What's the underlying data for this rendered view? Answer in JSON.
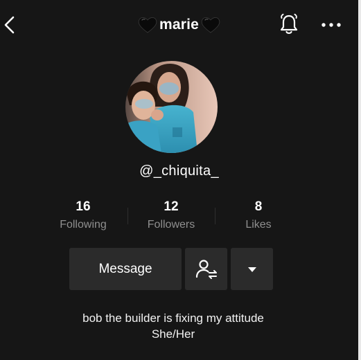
{
  "header": {
    "title": "marie",
    "icons": {
      "back": "chevron-left-icon",
      "bell": "bell-icon",
      "more": "more-horizontal-icon",
      "decoration": "black-heart-icon"
    }
  },
  "profile": {
    "username": "@_chiquita_",
    "avatar": "profile-photo"
  },
  "stats": [
    {
      "value": "16",
      "label": "Following"
    },
    {
      "value": "12",
      "label": "Followers"
    },
    {
      "value": "8",
      "label": "Likes"
    }
  ],
  "actions": {
    "message_label": "Message",
    "follow_icon": "add-friend-icon",
    "dropdown_icon": "caret-down-icon"
  },
  "bio": {
    "line1": "bob the builder is fixing my attitude",
    "line2": "She/Her"
  },
  "colors": {
    "background": "#161616",
    "button": "#2b2b2b",
    "muted_text": "#8f8f8f",
    "text": "#ffffff"
  }
}
